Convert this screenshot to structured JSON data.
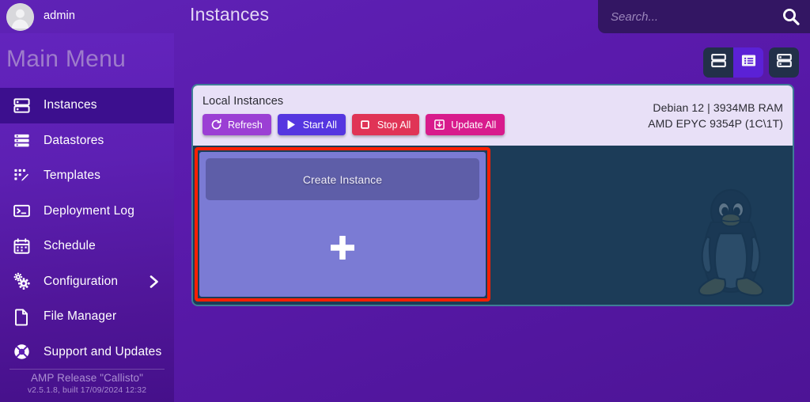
{
  "app": {
    "accent_purple": "#5a1aac",
    "active_item_purple": "#3c0f8e",
    "panel_bg": "#1c3c58",
    "panel_border": "#3f7d96",
    "highlight_border": "#ff1f00"
  },
  "topbar": {
    "username": "admin",
    "avatar_icon": "user-avatar-icon",
    "page_title": "Instances",
    "search": {
      "placeholder": "Search...",
      "value": "",
      "icon": "search-icon"
    }
  },
  "sidebar": {
    "heading": "Main Menu",
    "items": [
      {
        "label": "Instances",
        "icon": "server-stack-icon",
        "active": true,
        "has_chevron": false
      },
      {
        "label": "Datastores",
        "icon": "database-list-icon",
        "active": false,
        "has_chevron": false
      },
      {
        "label": "Templates",
        "icon": "template-pencil-icon",
        "active": false,
        "has_chevron": false
      },
      {
        "label": "Deployment Log",
        "icon": "terminal-icon",
        "active": false,
        "has_chevron": false
      },
      {
        "label": "Schedule",
        "icon": "calendar-icon",
        "active": false,
        "has_chevron": false
      },
      {
        "label": "Configuration",
        "icon": "gears-icon",
        "active": false,
        "has_chevron": true
      },
      {
        "label": "File Manager",
        "icon": "document-icon",
        "active": false,
        "has_chevron": false
      },
      {
        "label": "Support and Updates",
        "icon": "lifebuoy-icon",
        "active": false,
        "has_chevron": false
      }
    ],
    "footer": {
      "release": "AMP Release \"Callisto\"",
      "version": "v2.5.1.8, built 17/09/2024 12:32"
    }
  },
  "view_toggles": [
    {
      "name": "rows-view",
      "icon": "rows-view-icon",
      "active": false
    },
    {
      "name": "list-view",
      "icon": "list-view-icon",
      "active": true
    },
    {
      "name": "compact-view",
      "icon": "compact-view-icon",
      "active": false
    }
  ],
  "panel": {
    "title": "Local Instances",
    "actions": [
      {
        "label": "Refresh",
        "icon": "refresh-icon",
        "color": "#9b3fd4"
      },
      {
        "label": "Start All",
        "icon": "play-icon",
        "color": "#5536e0"
      },
      {
        "label": "Stop All",
        "icon": "stop-icon",
        "color": "#e03456"
      },
      {
        "label": "Update All",
        "icon": "download-icon",
        "color": "#d81b8c"
      }
    ],
    "system_info": {
      "line1": "Debian  12 | 3934MB RAM",
      "line2": "AMD EPYC 9354P (1C\\1T)"
    },
    "watermark_icon": "tux-penguin-icon",
    "create_card": {
      "title": "Create Instance",
      "add_icon": "plus-icon",
      "highlighted": true
    }
  }
}
